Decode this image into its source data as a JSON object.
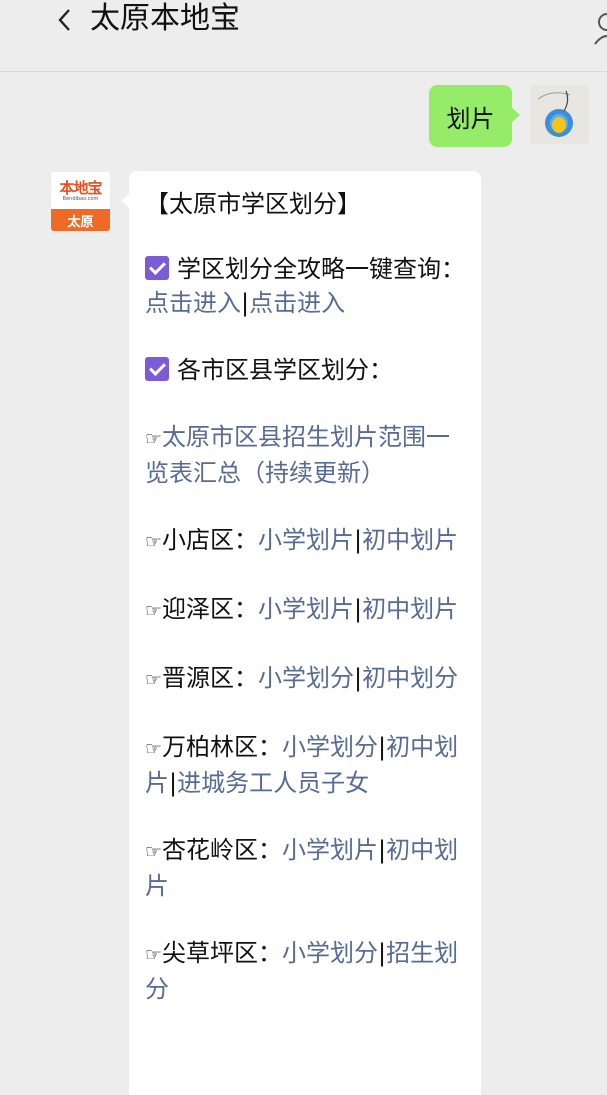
{
  "header": {
    "title": "太原本地宝",
    "back_icon": "chevron-left-icon",
    "profile_icon": "person-icon"
  },
  "sent_message": {
    "text": "划片",
    "bubble_color": "#95ec69"
  },
  "official_account": {
    "logo_text": "本地宝",
    "logo_domain": "Bendibao.com",
    "city": "太原"
  },
  "reply": {
    "heading": "【太原市学区划分】",
    "guide_label": "学区划分全攻略一键查询：",
    "guide_link_1": "点击进入",
    "guide_sep": "|",
    "guide_link_2": "点击进入",
    "districts_label": "各市区县学区划分：",
    "hand": "☞",
    "summary_link": "太原市区县招生划片范围一览表汇总（持续更新）",
    "link_color": "#576b95",
    "items": [
      {
        "name": "小店区：",
        "links": [
          "小学划片",
          "初中划片"
        ]
      },
      {
        "name": "迎泽区：",
        "links": [
          "小学划片",
          "初中划片"
        ]
      },
      {
        "name": "晋源区：",
        "links": [
          "小学划分",
          "初中划分"
        ]
      },
      {
        "name": "万柏林区：",
        "links": [
          "小学划分",
          "初中划片",
          "进城务工人员子女"
        ]
      },
      {
        "name": "杏花岭区：",
        "links": [
          "小学划片",
          "初中划片"
        ]
      },
      {
        "name": "尖草坪区：",
        "links": [
          "小学划分",
          "招生划分"
        ]
      }
    ]
  }
}
